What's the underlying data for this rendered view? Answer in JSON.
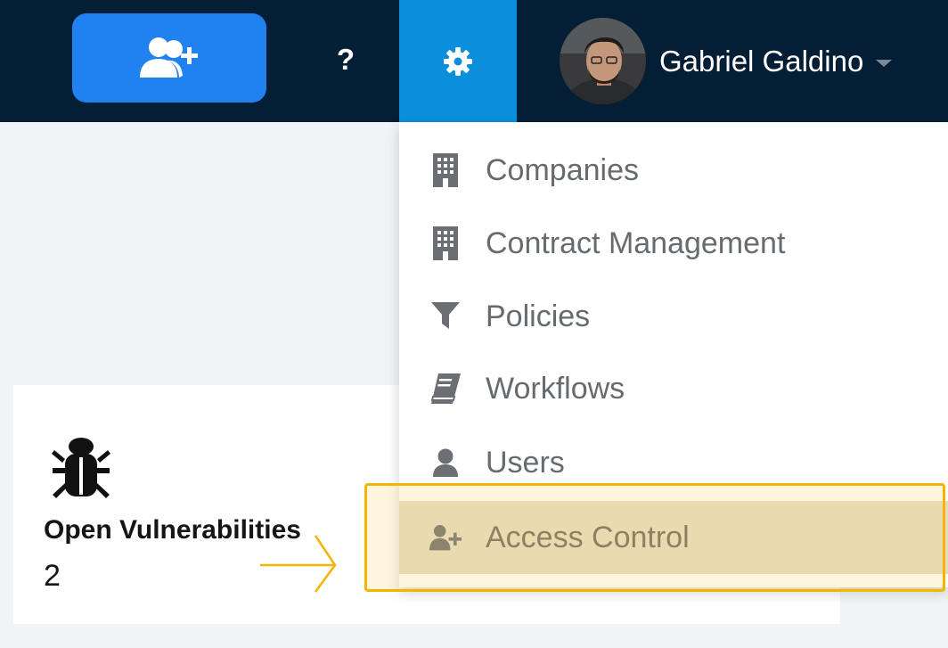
{
  "header": {
    "help_label": "?",
    "user_name": "Gabriel Galdino"
  },
  "card": {
    "title": "Open Vulnerabilities",
    "value": "2"
  },
  "settings_menu": {
    "items": [
      {
        "label": "Companies",
        "icon": "building-icon"
      },
      {
        "label": "Contract Management",
        "icon": "building-icon"
      },
      {
        "label": "Policies",
        "icon": "filter-icon"
      },
      {
        "label": "Workflows",
        "icon": "book-icon"
      },
      {
        "label": "Users",
        "icon": "user-icon"
      },
      {
        "label": "Access Control",
        "icon": "user-plus-icon",
        "highlighted": true
      }
    ]
  },
  "colors": {
    "navbar_bg": "#041e35",
    "invite_button": "#1f82f0",
    "settings_active": "#0b8fdc",
    "highlight": "#f5b400"
  }
}
